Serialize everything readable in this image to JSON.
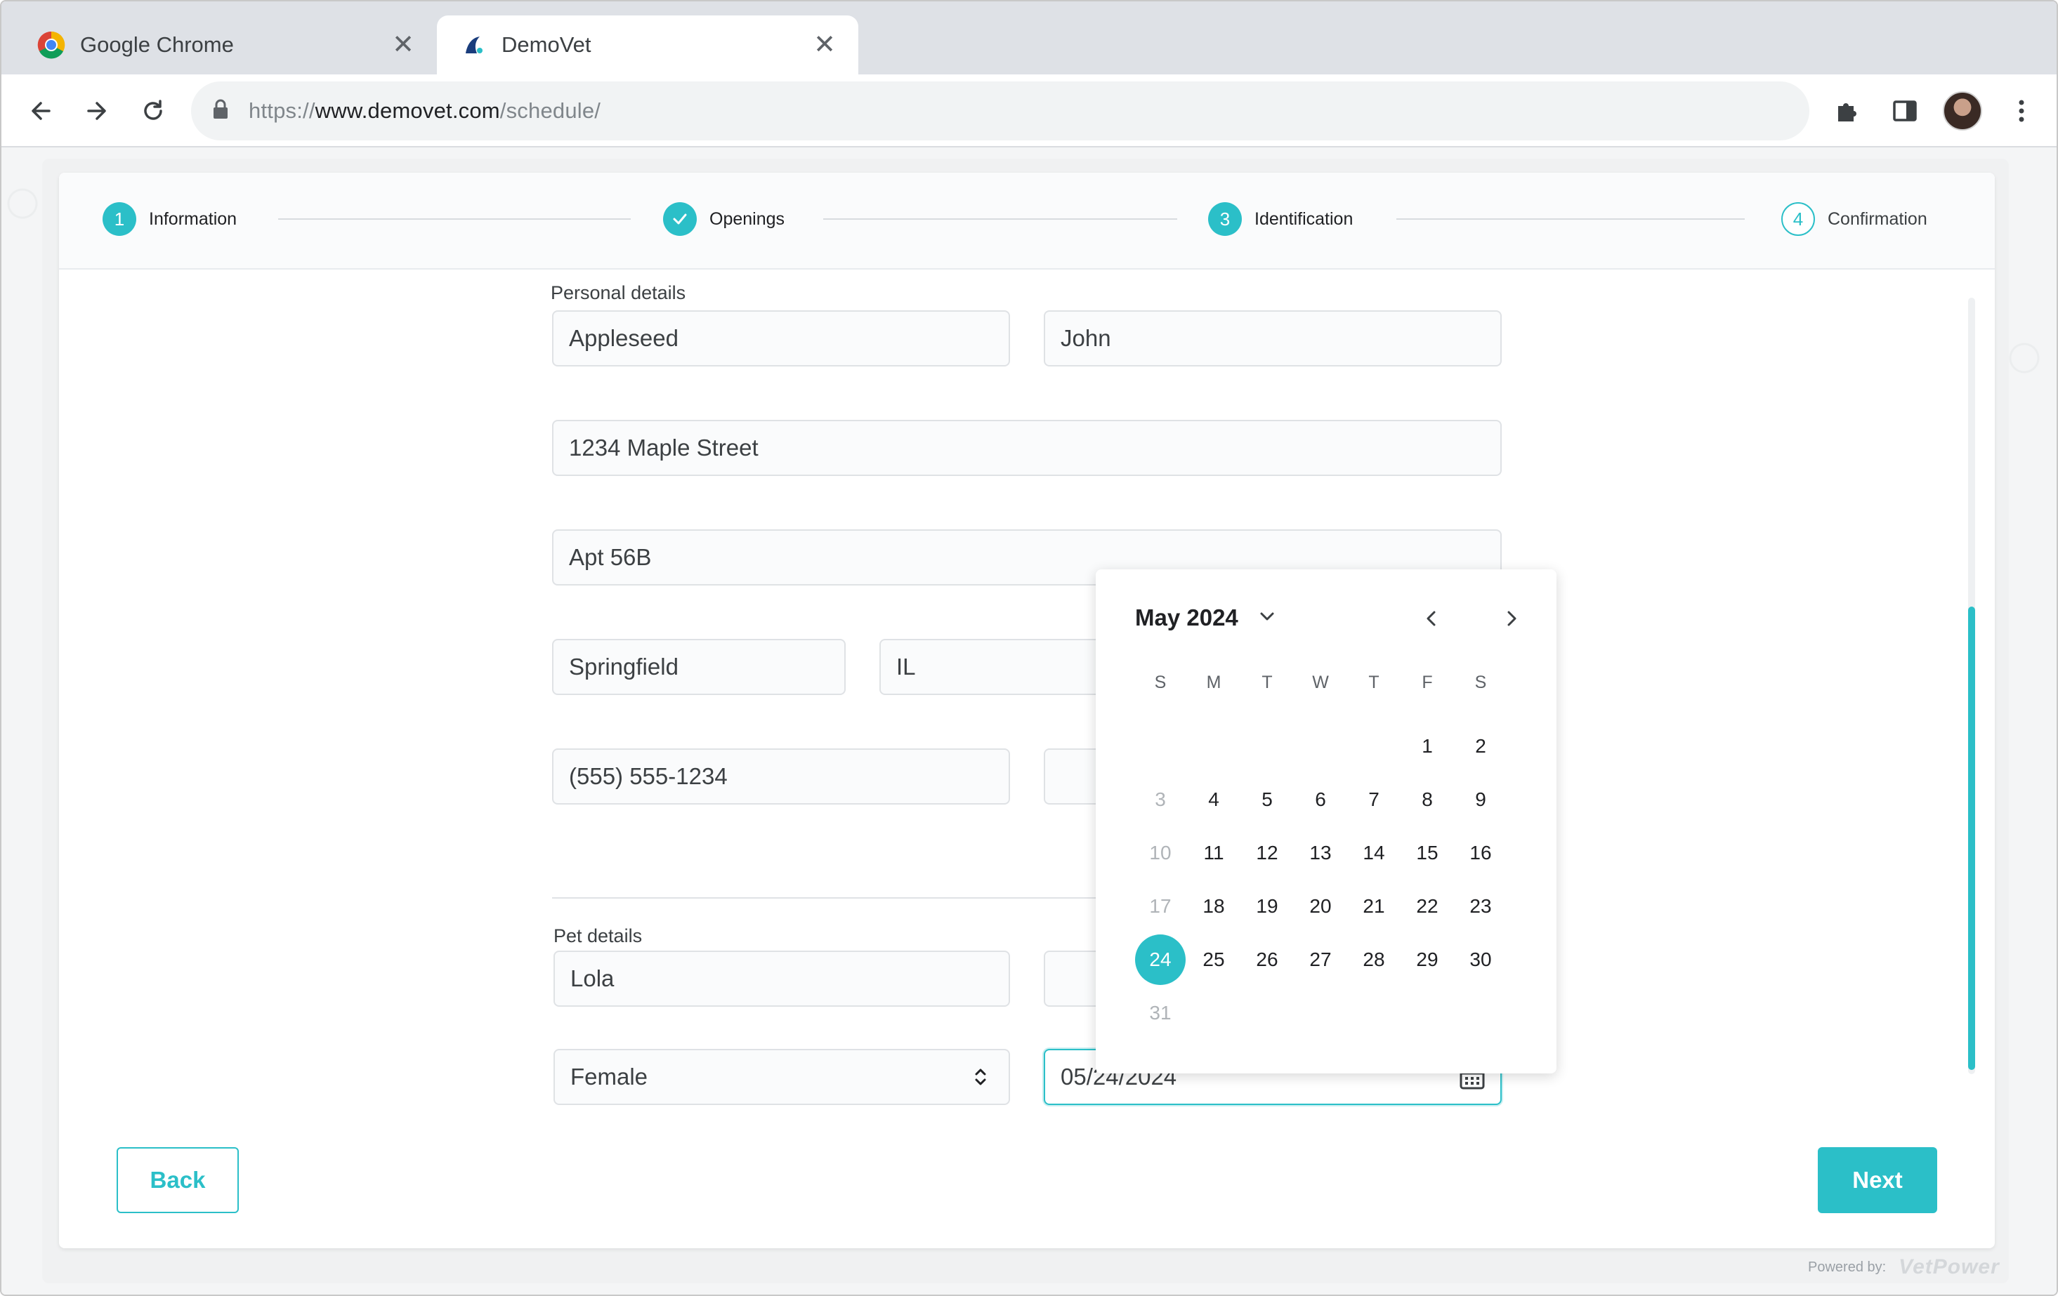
{
  "browser": {
    "tabs": [
      {
        "title": "Google Chrome",
        "active": false
      },
      {
        "title": "DemoVet",
        "active": true
      }
    ],
    "url": {
      "scheme": "https://",
      "host": "www.demovet.com",
      "path": "/schedule/"
    }
  },
  "colors": {
    "accent": "#2bbfc8"
  },
  "stepper": [
    {
      "num": "1",
      "label": "Information",
      "state": "active"
    },
    {
      "num": "",
      "label": "Openings",
      "state": "done"
    },
    {
      "num": "3",
      "label": "Identification",
      "state": "active"
    },
    {
      "num": "4",
      "label": "Confirmation",
      "state": "pending"
    }
  ],
  "personal": {
    "section_label": "Personal details",
    "last_name": "Appleseed",
    "first_name": "John",
    "address1": "1234 Maple Street",
    "address2": "Apt 56B",
    "city": "Springfield",
    "state": "IL",
    "phone": "(555) 555-1234"
  },
  "pet": {
    "section_label": "Pet details",
    "name": "Lola",
    "sex": "Female",
    "birthdate": "05/24/2024"
  },
  "calendar": {
    "month": "May",
    "year": "2024",
    "weekdays": [
      "S",
      "M",
      "T",
      "W",
      "T",
      "F",
      "S"
    ],
    "weeks": [
      [
        "",
        "",
        "",
        "",
        "",
        "1",
        "2"
      ],
      [
        "3",
        "4",
        "5",
        "6",
        "7",
        "8",
        "9"
      ],
      [
        "10",
        "11",
        "12",
        "13",
        "14",
        "15",
        "16"
      ],
      [
        "17",
        "18",
        "19",
        "20",
        "21",
        "22",
        "23"
      ],
      [
        "24",
        "25",
        "26",
        "27",
        "28",
        "29",
        "30"
      ],
      [
        "31",
        "",
        "",
        "",
        "",
        "",
        ""
      ]
    ],
    "disabled": [
      "3",
      "10",
      "17",
      "31"
    ],
    "selected": "24"
  },
  "actions": {
    "back": "Back",
    "next": "Next"
  },
  "footer": {
    "powered_by": "Powered by:",
    "brand": "VetPower"
  }
}
